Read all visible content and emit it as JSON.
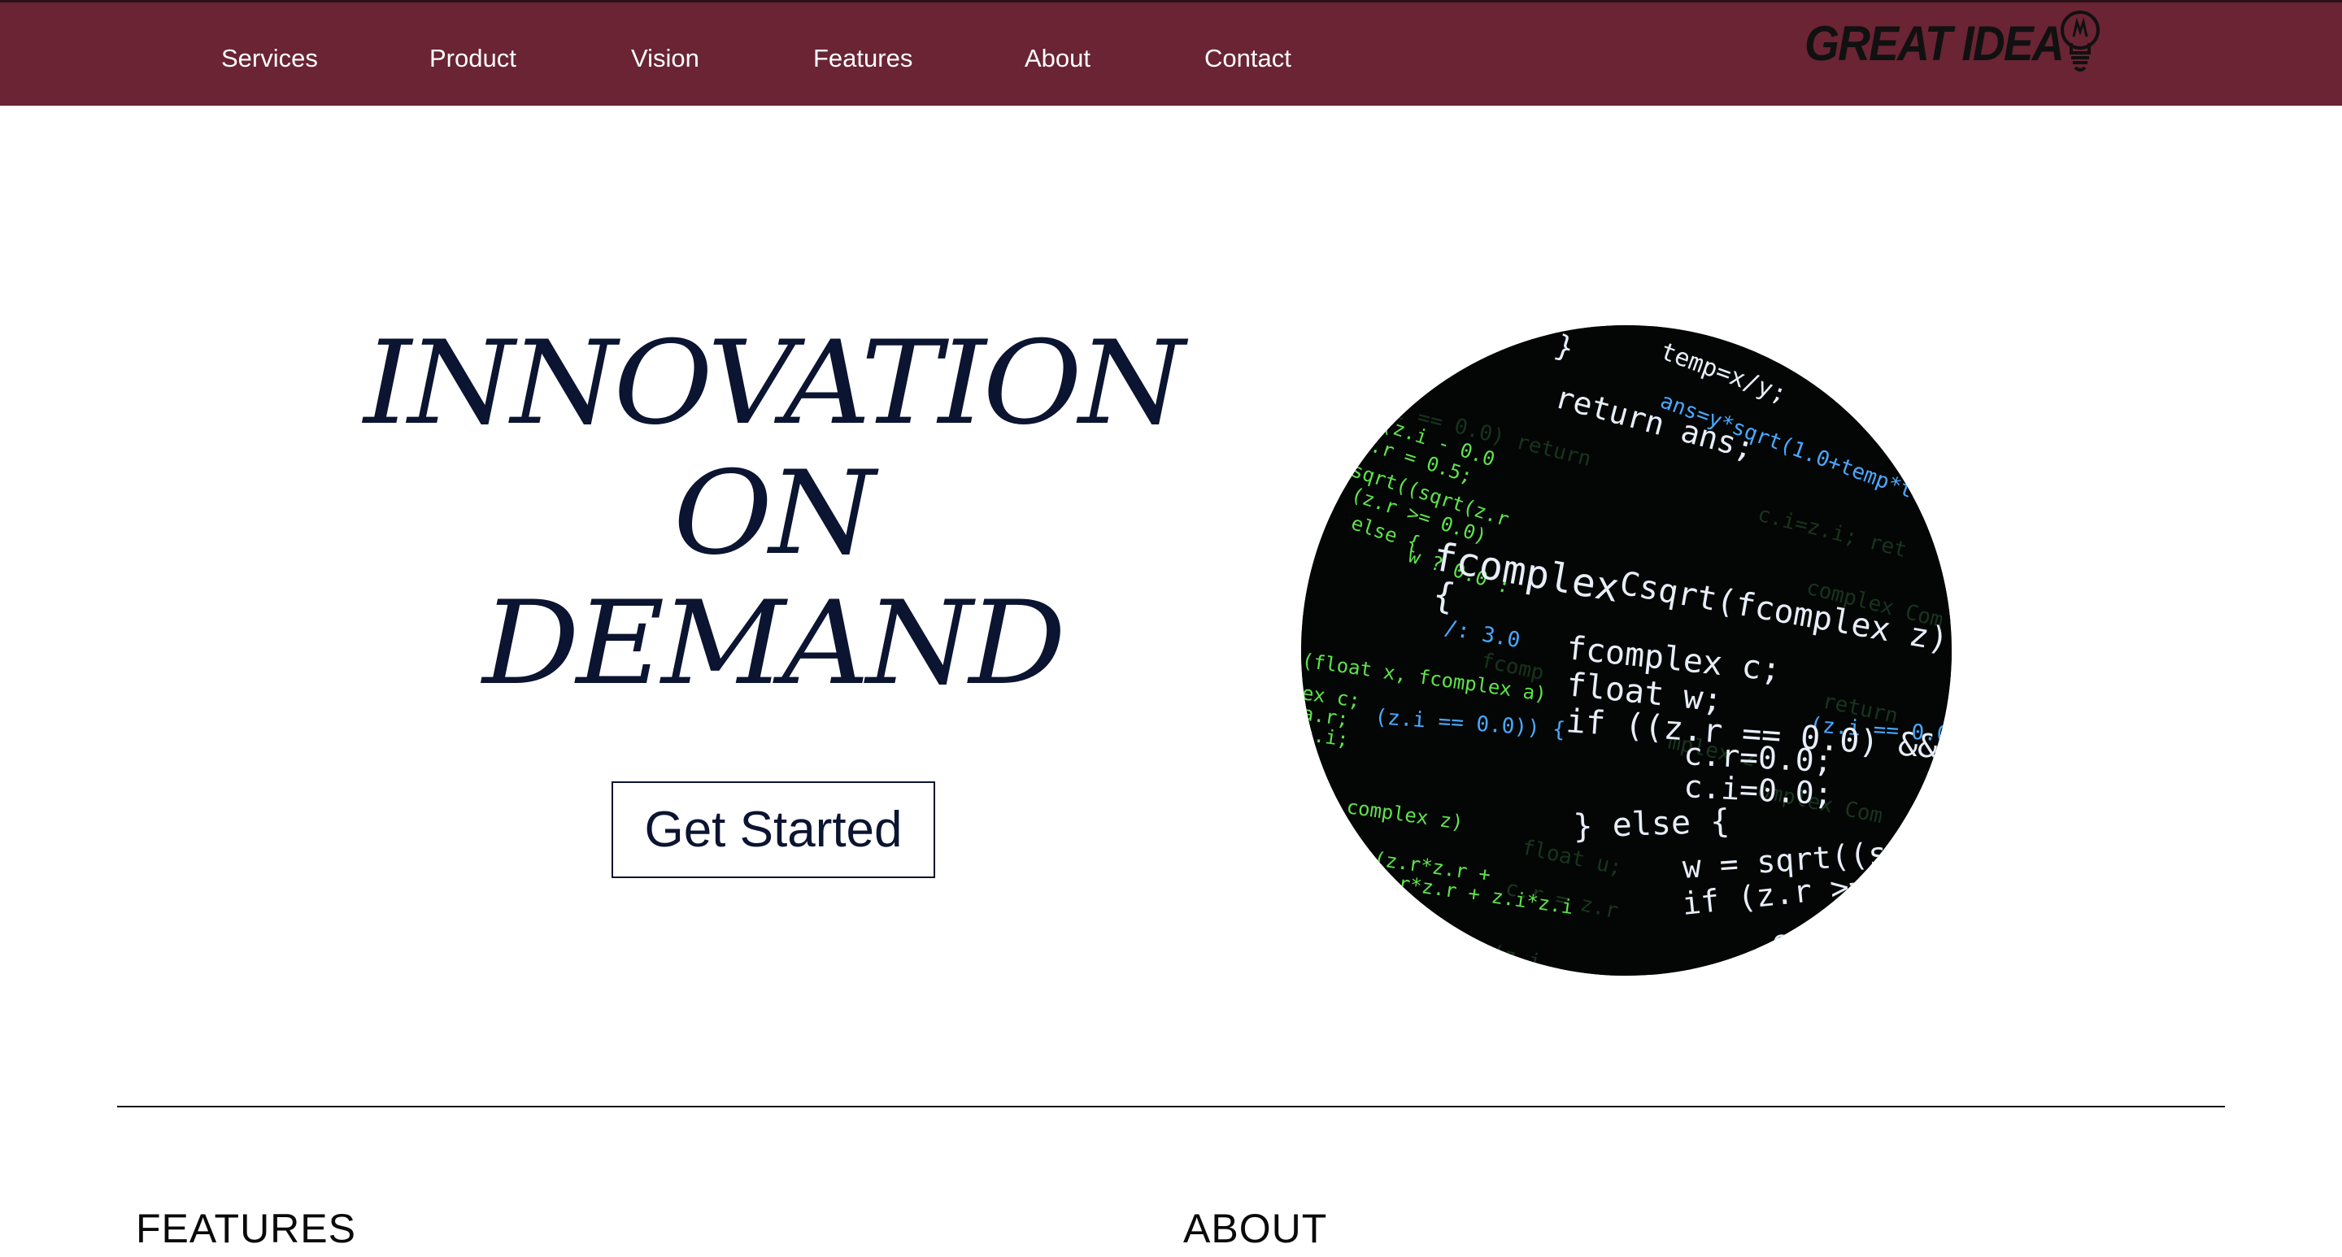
{
  "nav": {
    "links": [
      {
        "label": "Services"
      },
      {
        "label": "Product"
      },
      {
        "label": "Vision"
      },
      {
        "label": "Features"
      },
      {
        "label": "About"
      },
      {
        "label": "Contact"
      }
    ],
    "logo_text": "GREAT IDEA",
    "logo_icon": "lightbulb-icon"
  },
  "hero": {
    "title_lines": [
      "INNOVATION",
      "ON",
      "DEMAND"
    ],
    "cta_label": "Get Started",
    "image_description": "circular-code-image"
  },
  "sections": {
    "features_heading": "FEATURES",
    "about_heading": "ABOUT"
  },
  "colors": {
    "nav_background": "#6a2434",
    "nav_text": "#ffffff",
    "hero_text": "#0b1430",
    "page_background": "#ffffff",
    "code_green": "#58e04a",
    "code_blue": "#4aa8ff",
    "code_white": "#e8eef8"
  }
}
